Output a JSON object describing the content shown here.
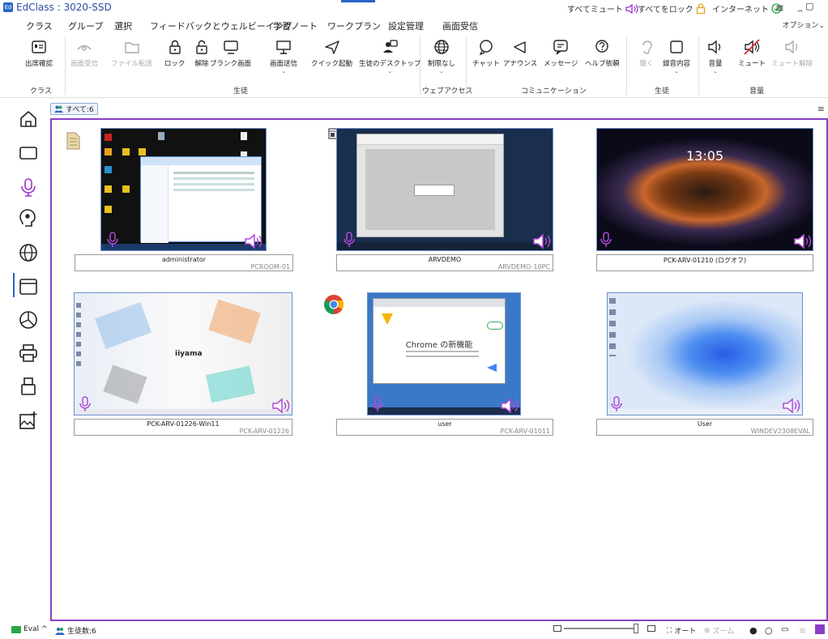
{
  "window": {
    "title": "EdClass : 3020-SSD",
    "logo_text": "Ed",
    "mute_all": "すべてミュート",
    "lock_all": "すべてをロック",
    "internet": "インターネット",
    "options": "オプション"
  },
  "menu": [
    "クラス",
    "グループ",
    "選択",
    "フィードバックとウェルビーイング",
    "学習ノート",
    "ワークプラン",
    "設定管理",
    "画面受信"
  ],
  "ribbon": {
    "buttons": [
      {
        "label": "出席確認",
        "icon": "attendance-icon"
      },
      {
        "label": "画面受信",
        "icon": "eye-icon"
      },
      {
        "label": "ファイル転送",
        "icon": "folder-icon"
      },
      {
        "label": "ロック",
        "icon": "lock-icon"
      },
      {
        "label": "解除",
        "icon": "unlock-icon"
      },
      {
        "label": "ブランク画面",
        "icon": "blank-screen-icon"
      },
      {
        "label": "画面送信",
        "icon": "broadcast-icon"
      },
      {
        "label": "クイック起動",
        "icon": "send-icon"
      },
      {
        "label": "生徒のデスクトップ",
        "icon": "student-desktop-icon"
      },
      {
        "label": "制限なし",
        "icon": "globe-icon"
      },
      {
        "label": "チャット",
        "icon": "chat-icon"
      },
      {
        "label": "アナウンス",
        "icon": "announce-icon"
      },
      {
        "label": "メッセージ",
        "icon": "message-icon"
      },
      {
        "label": "ヘルプ依頼",
        "icon": "help-icon"
      },
      {
        "label": "聴く",
        "icon": "listen-icon"
      },
      {
        "label": "録音内容",
        "icon": "recording-icon"
      },
      {
        "label": "音量",
        "icon": "volume-icon"
      },
      {
        "label": "ミュート",
        "icon": "mute-icon"
      },
      {
        "label": "ミュート解除",
        "icon": "unmute-icon"
      }
    ],
    "groups": [
      "クラス",
      "生徒",
      "ウェブアクセス",
      "コミュニケーション",
      "生徒",
      "音量"
    ]
  },
  "filter": {
    "label": "すべて:6"
  },
  "students": [
    {
      "user": "administrator",
      "pc": "PCROOM-01"
    },
    {
      "user": "ARVDEMO",
      "pc": "ARVDEMO-10PC"
    },
    {
      "user": "PCK-ARV-01210 (ログオフ)",
      "pc": ""
    },
    {
      "user": "PCK-ARV-01226-Win11",
      "pc": "PCK-ARV-01226"
    },
    {
      "user": "user",
      "pc": "PCK-ARV-01011"
    },
    {
      "user": "User",
      "pc": "WINDEV2308EVAL"
    }
  ],
  "screens": {
    "clock": "13:05",
    "iiyama": "iiyama",
    "chrome_heading": "Chrome の新機能"
  },
  "status": {
    "eval": "Eval",
    "students_count": "生徒数:6",
    "auto": "オート",
    "zoom": "ズーム"
  },
  "colors": {
    "accent": "#2a64c8",
    "frame": "#8a3fc4",
    "purple": "#9b30d0"
  }
}
